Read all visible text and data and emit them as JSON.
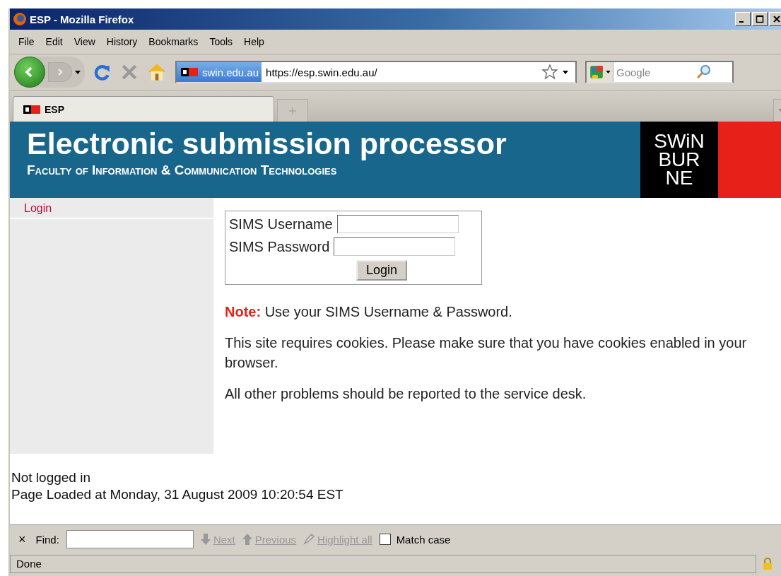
{
  "window": {
    "title": "ESP - Mozilla Firefox"
  },
  "menu": [
    "File",
    "Edit",
    "View",
    "History",
    "Bookmarks",
    "Tools",
    "Help"
  ],
  "address": {
    "site_badge": "swin.edu.au",
    "url": "https://esp.swin.edu.au/"
  },
  "search": {
    "placeholder": "Google"
  },
  "tabs": [
    {
      "label": "ESP",
      "selected": true
    }
  ],
  "header": {
    "title": "Electronic submission processor",
    "subtitle": "Faculty of Information & Communication Technologies",
    "logo_lines": [
      "SWiN",
      "BUR",
      "NE"
    ]
  },
  "sidebar": {
    "items": [
      {
        "label": "Login",
        "selected": false
      }
    ]
  },
  "login_form": {
    "fields": [
      {
        "label": "SIMS Username"
      },
      {
        "label": "SIMS Password"
      }
    ],
    "button": "Login"
  },
  "notes": [
    "**Note:** Use your SIMS Username & Password.",
    "This site requires cookies. Please make sure that you have cookies enabled in your browser.",
    "All other problems should be reported to the service desk."
  ],
  "footer": [
    "Not logged in",
    "Page Loaded at Monday, 31 August 2009 10:20:54 EST"
  ],
  "find_bar": {
    "close": "×",
    "label": "Find:",
    "buttons": [
      {
        "label": "Next",
        "disabled": true
      },
      {
        "label": "Previous",
        "disabled": true
      },
      {
        "label": "Highlight all",
        "disabled": true
      }
    ],
    "match_case": {
      "label": "Match case",
      "checked": false
    }
  },
  "status_bar": {
    "text": "Done"
  }
}
